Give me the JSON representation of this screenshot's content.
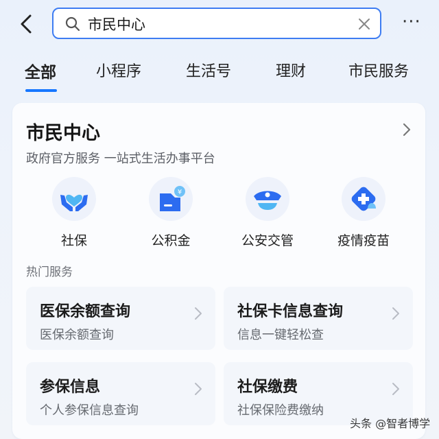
{
  "search": {
    "value": "市民中心"
  },
  "tabs": [
    {
      "label": "全部"
    },
    {
      "label": "小程序"
    },
    {
      "label": "生活号"
    },
    {
      "label": "理财"
    },
    {
      "label": "市民服务"
    }
  ],
  "card": {
    "title": "市民中心",
    "subtitle": "政府官方服务 一站式生活办事平台",
    "services": [
      {
        "label": "社保",
        "icon": "hands-heart-icon"
      },
      {
        "label": "公积金",
        "icon": "yuan-badge-icon"
      },
      {
        "label": "公安交管",
        "icon": "police-cap-icon"
      },
      {
        "label": "疫情疫苗",
        "icon": "vaccine-plus-icon"
      }
    ],
    "hot_title": "热门服务",
    "hot_items": [
      {
        "title": "医保余额查询",
        "desc": "医保余额查询"
      },
      {
        "title": "社保卡信息查询",
        "desc": "信息一键轻松查"
      },
      {
        "title": "参保信息",
        "desc": "个人参保信息查询"
      },
      {
        "title": "社保缴费",
        "desc": "社保保险费缴纳"
      }
    ]
  },
  "watermark": "头条 @智者博学",
  "colors": {
    "accent": "#1677ff",
    "search_border": "#3d7cf2"
  }
}
